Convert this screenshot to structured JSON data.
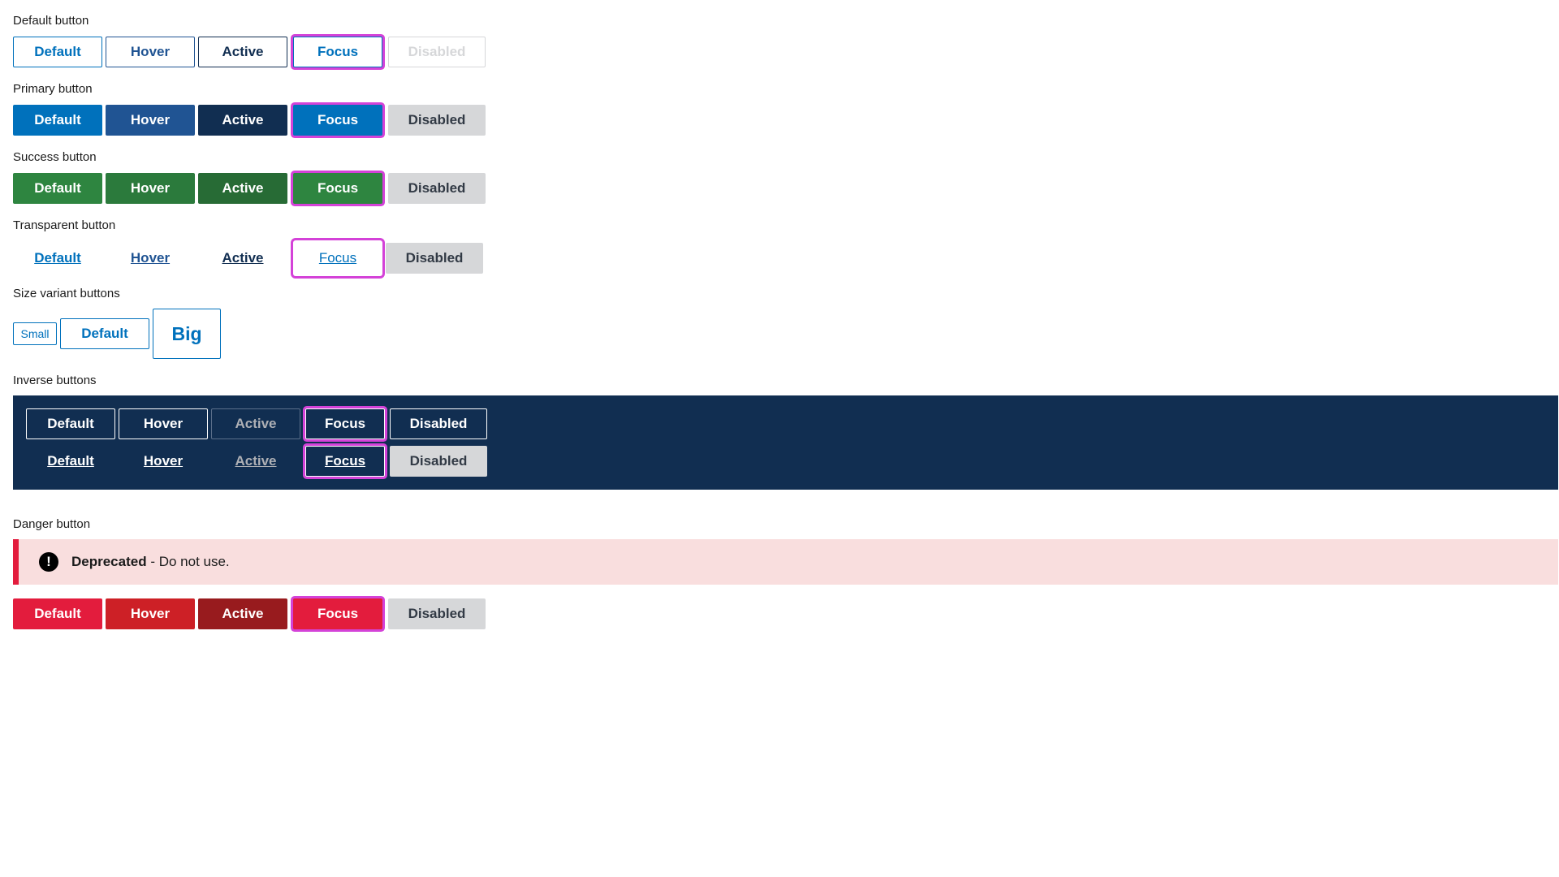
{
  "sections": {
    "default_label": "Default button",
    "primary_label": "Primary button",
    "success_label": "Success button",
    "transparent_label": "Transparent button",
    "size_label": "Size variant buttons",
    "inverse_label": "Inverse buttons",
    "danger_label": "Danger button"
  },
  "states": {
    "default": "Default",
    "hover": "Hover",
    "active": "Active",
    "focus": "Focus",
    "disabled": "Disabled"
  },
  "sizes": {
    "small": "Small",
    "default": "Default",
    "big": "Big"
  },
  "alert": {
    "icon": "exclamation-circle-icon",
    "title": "Deprecated",
    "message": " - Do not use."
  },
  "colors": {
    "primary": "#0071bc",
    "primary_hover": "#205493",
    "primary_active": "#112e51",
    "success": "#2e8540",
    "danger": "#e31c3d",
    "focus_ring": "#d442d8",
    "disabled_bg": "#d6d7d9",
    "inverse_bg": "#112e51",
    "alert_bg": "#f9dede"
  }
}
